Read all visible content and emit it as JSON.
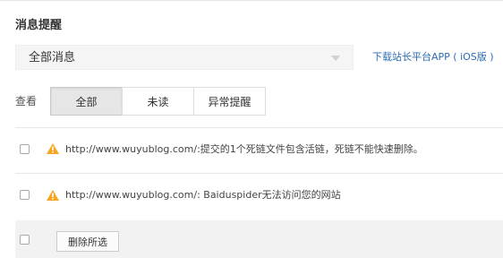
{
  "header": {
    "title": "消息提醒"
  },
  "filter": {
    "selected": "全部消息",
    "download_link": "下载站长平台APP ( iOS版 )"
  },
  "view": {
    "label": "查看",
    "tabs": [
      {
        "label": "全部",
        "active": true
      },
      {
        "label": "未读",
        "active": false
      },
      {
        "label": "异常提醒",
        "active": false
      }
    ]
  },
  "messages": [
    {
      "icon": "warning-icon",
      "text": "http://www.wuyublog.com/:提交的1个死链文件包含活链，死链不能快速删除。"
    },
    {
      "icon": "warning-icon",
      "text": "http://www.wuyublog.com/: Baiduspider无法访问您的网站"
    }
  ],
  "footer": {
    "delete_label": "删除所选"
  },
  "colors": {
    "accent_link": "#2b6cb6",
    "warning": "#f5a623",
    "active_tab_bg": "#e6e6e6",
    "footer_bg": "#f2f2f2"
  }
}
